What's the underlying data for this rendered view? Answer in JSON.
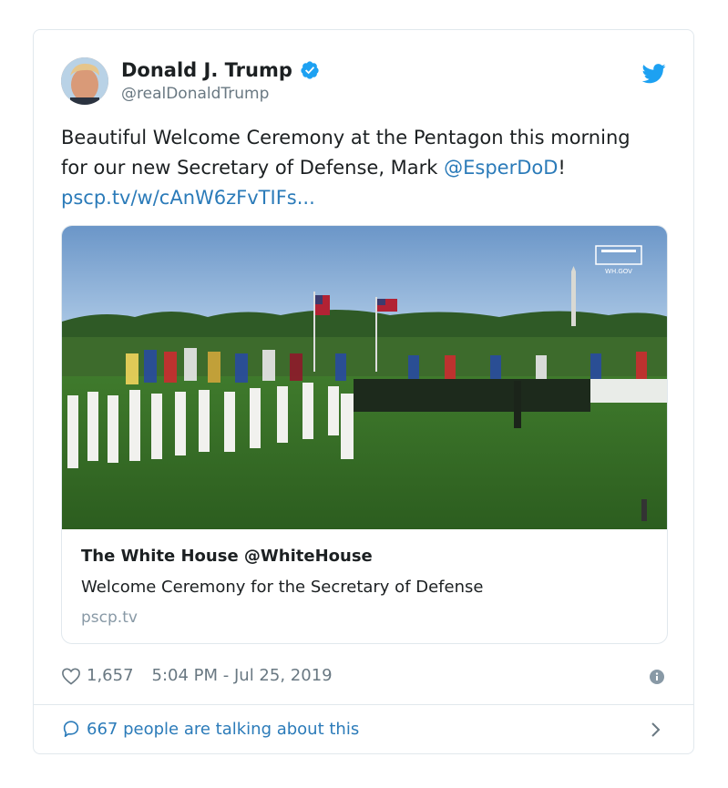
{
  "author": {
    "name": "Donald J. Trump",
    "handle": "@realDonaldTrump",
    "verified": true
  },
  "tweet": {
    "text_before": "Beautiful Welcome Ceremony at the Pentagon this morning for our new Secretary of Defense, Mark ",
    "mention": "@EsperDoD",
    "text_after": "! ",
    "link": "pscp.tv/w/cAnW6zFvTIFs..."
  },
  "card": {
    "title": "The White House @WhiteHouse",
    "description": "Welcome Ceremony for the Secretary of Defense",
    "domain": "pscp.tv",
    "watermark": "WH.GOV"
  },
  "stats": {
    "likes": "1,657",
    "timestamp": "5:04 PM - Jul 25, 2019"
  },
  "footer": {
    "conversation": "667 people are talking about this"
  },
  "colors": {
    "link": "#2b7bb9",
    "twitter_blue": "#1da1f2",
    "muted": "#697882"
  },
  "icons": [
    "avatar",
    "verified-badge-icon",
    "twitter-bird-icon",
    "heart-icon",
    "info-icon",
    "speech-bubble-icon",
    "chevron-right-icon"
  ]
}
